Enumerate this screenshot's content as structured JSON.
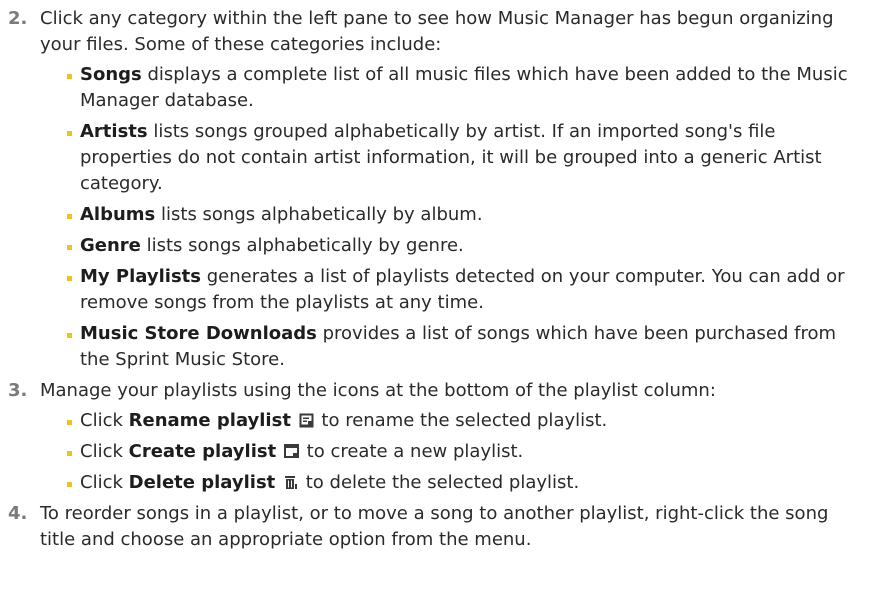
{
  "steps": [
    {
      "number": "2.",
      "text": "Click any category within the left pane to see how Music Manager has begun organizing your files. Some of these categories include:",
      "bullets": [
        {
          "term": "Songs",
          "text": " displays a complete list of all music files which have been added to the Music Manager database."
        },
        {
          "term": "Artists",
          "text": " lists songs grouped alphabetically by artist. If an imported song's file properties do not contain artist information, it will be grouped into a generic Artist category."
        },
        {
          "term": "Albums",
          "text": " lists songs alphabetically by album."
        },
        {
          "term": "Genre",
          "text": " lists songs alphabetically by genre."
        },
        {
          "term": "My Playlists",
          "text": " generates a list of playlists detected on your computer. You can add or remove songs from the playlists at any time."
        },
        {
          "term": "Music Store Downloads",
          "text": " provides a list of songs which have been purchased from the Sprint Music Store."
        }
      ]
    },
    {
      "number": "3.",
      "text": "Manage your playlists using the icons at the bottom of the playlist column:",
      "bullets": [
        {
          "prefix": "Click ",
          "term": "Rename playlist",
          "icon": "rename-playlist-icon",
          "text": " to rename the selected playlist."
        },
        {
          "prefix": "Click ",
          "term": "Create playlist",
          "icon": "create-playlist-icon",
          "text": " to create a new playlist."
        },
        {
          "prefix": "Click ",
          "term": "Delete playlist",
          "icon": "delete-playlist-icon",
          "text": " to delete the selected playlist."
        }
      ]
    },
    {
      "number": "4.",
      "text": "To reorder songs in a playlist, or to move a song to another playlist, right-click the song title and choose an appropriate option from the menu."
    }
  ],
  "colors": {
    "bullet": "#f2c21a",
    "step_number": "#7a7a7a",
    "text": "#2a2a2a"
  }
}
